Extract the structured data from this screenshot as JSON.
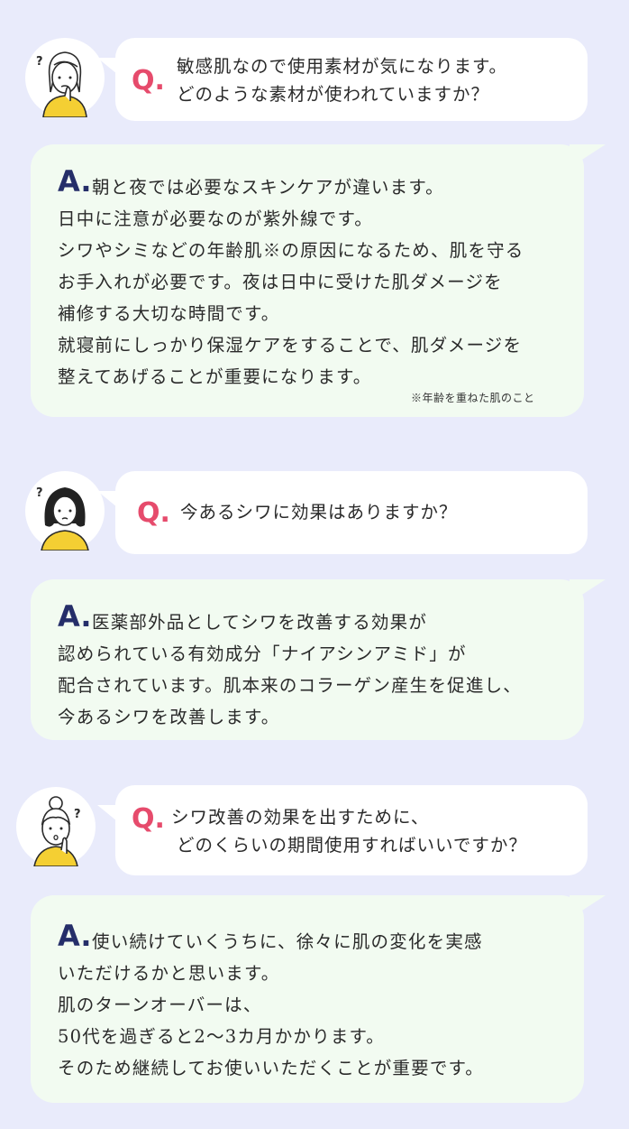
{
  "colors": {
    "background": "#e9ebfb",
    "q_accent": "#e64b6c",
    "a_accent": "#252e69",
    "answer_bg": "#f2fbf1",
    "question_bg": "#ffffff",
    "avatar_shirt": "#f4cf33"
  },
  "faq": [
    {
      "avatar_icon": "woman-thinking-icon",
      "question_mark": "Q.",
      "question_lines": [
        "敏感肌なので使用素材が気になります。",
        "どのような素材が使われていますか？"
      ],
      "answer_mark": "A.",
      "answer_lines": [
        "朝と夜では必要なスキンケアが違います。",
        "日中に注意が必要なのが紫外線です。",
        "シワやシミなどの年齢肌※の原因になるため、肌を守る",
        "お手入れが必要です。夜は日中に受けた肌ダメージを",
        "補修する大切な時間です。",
        "就寝前にしっかり保湿ケアをすることで、肌ダメージを",
        "整えてあげることが重要になります。"
      ],
      "note": "※年齢を重ねた肌のこと"
    },
    {
      "avatar_icon": "woman-wondering-icon",
      "question_mark": "Q.",
      "question_lines": [
        "今あるシワに効果はありますか？"
      ],
      "answer_mark": "A.",
      "answer_lines": [
        "医薬部外品としてシワを改善する効果が",
        "認められている有効成分「ナイアシンアミド」が",
        "配合されています。肌本来のコラーゲン産生を促進し、",
        "今あるシワを改善します。"
      ]
    },
    {
      "avatar_icon": "woman-bun-thinking-icon",
      "question_mark": "Q.",
      "question_lines": [
        "シワ改善の効果を出すために、",
        "どのくらいの期間使用すればいいですか？"
      ],
      "answer_mark": "A.",
      "answer_lines": [
        "使い続けていくうちに、徐々に肌の変化を実感",
        "いただけるかと思います。",
        "肌のターンオーバーは、",
        "50代を過ぎると2〜3カ月かかります。",
        "そのため継続してお使いいただくことが重要です。"
      ]
    }
  ]
}
